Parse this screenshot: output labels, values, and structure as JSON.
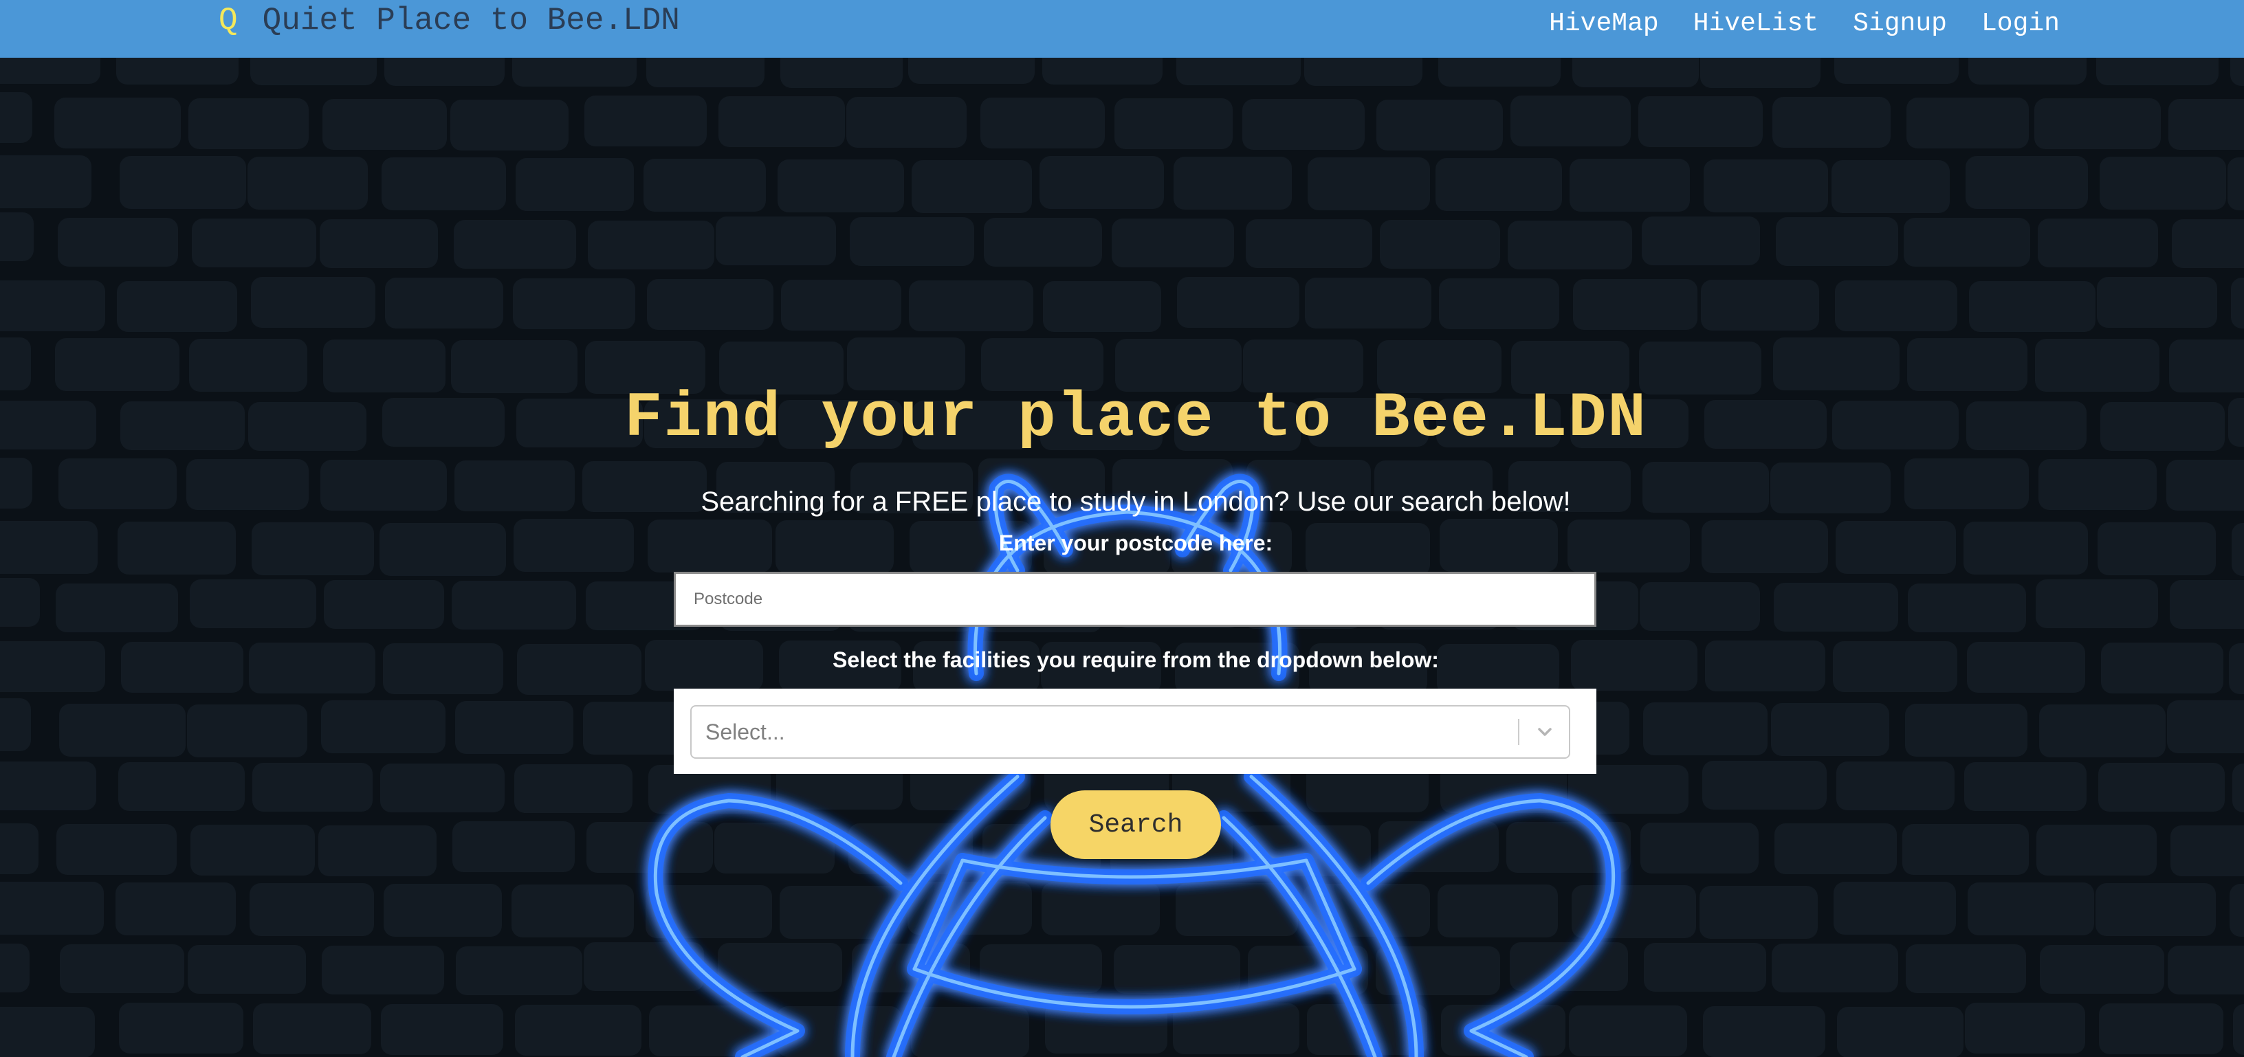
{
  "navbar": {
    "logo_glyph": "Q",
    "brand_name": "Quiet Place to Bee.LDN",
    "links": [
      "HiveMap",
      "HiveList",
      "Signup",
      "Login"
    ]
  },
  "hero": {
    "headline": "Find your place to Bee.LDN",
    "subtext": "Searching for a FREE place to study in London? Use our search below!"
  },
  "search_form": {
    "postcode_label": "Enter your postcode here:",
    "postcode_placeholder": "Postcode",
    "postcode_value": "",
    "facilities_label": "Select the facilities you require from the dropdown below:",
    "facilities_placeholder": "Select...",
    "search_label": "Search"
  },
  "colors": {
    "navbar_bg": "#4b97d7",
    "page_bg": "#0b1117",
    "accent_yellow": "#f5d36b",
    "neon_blue": "#2f86ff"
  },
  "icons": {
    "logo": "q-logo-icon",
    "dropdown": "chevron-down-icon",
    "background_bee": "neon-bee-icon"
  }
}
